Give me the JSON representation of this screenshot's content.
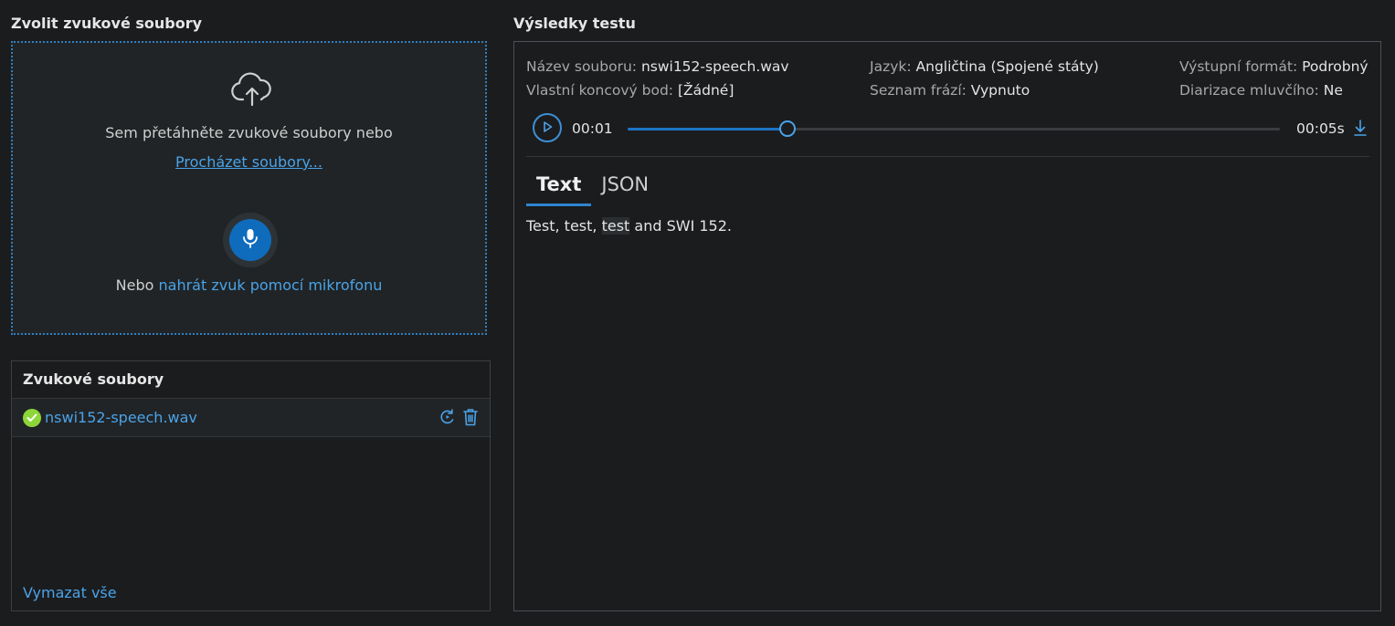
{
  "upload": {
    "title": "Zvolit zvukové soubory",
    "drop_text": "Sem přetáhněte zvukové soubory nebo",
    "browse_link": "Procházet soubory...",
    "record_prefix": "Nebo",
    "record_link": "nahrát zvuk pomocí mikrofonu"
  },
  "files": {
    "title": "Zvukové soubory",
    "items": [
      {
        "name": "nswi152-speech.wav",
        "status": "success"
      }
    ],
    "clear_all": "Vymazat vše"
  },
  "results": {
    "title": "Výsledky testu",
    "meta": {
      "file_name_label": "Název souboru:",
      "file_name_value": "nswi152-speech.wav",
      "endpoint_label": "Vlastní koncový bod:",
      "endpoint_value": "[Žádné]",
      "language_label": "Jazyk:",
      "language_value": "Angličtina (Spojené státy)",
      "phrase_list_label": "Seznam frází:",
      "phrase_list_value": "Vypnuto",
      "output_format_label": "Výstupní formát:",
      "output_format_value": "Podrobný",
      "diarization_label": "Diarizace mluvčího:",
      "diarization_value": "Ne"
    },
    "player": {
      "current_time": "00:01",
      "total_time": "00:05s",
      "progress": 0.245
    },
    "tabs": [
      {
        "label": "Text",
        "active": true
      },
      {
        "label": "JSON",
        "active": false
      }
    ],
    "transcript": {
      "before": "Test, test, ",
      "highlight": "test",
      "after": " and SWI 152."
    }
  },
  "colors": {
    "background": "#1b1c1e",
    "accent": "#0f6cbd",
    "link": "#4aa3e8",
    "success": "#8dd63a"
  },
  "icons": [
    "cloud-upload-icon",
    "microphone-icon",
    "check-circle-icon",
    "retry-icon",
    "trash-icon",
    "play-icon",
    "download-icon"
  ]
}
